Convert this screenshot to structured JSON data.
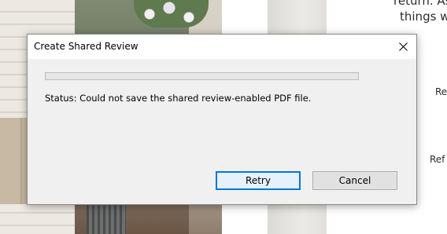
{
  "background": {
    "text_lines": [
      "return. As",
      "things we",
      "Re",
      "Ref"
    ]
  },
  "dialog": {
    "title": "Create Shared Review",
    "close_icon": "close-icon",
    "progress": {
      "value": 0
    },
    "status_text": "Status: Could not save the shared review-enabled PDF file.",
    "buttons": {
      "retry_label": "Retry",
      "cancel_label": "Cancel"
    },
    "colors": {
      "focus_border": "#0078d7",
      "dialog_bg": "#f0f0f0"
    }
  }
}
